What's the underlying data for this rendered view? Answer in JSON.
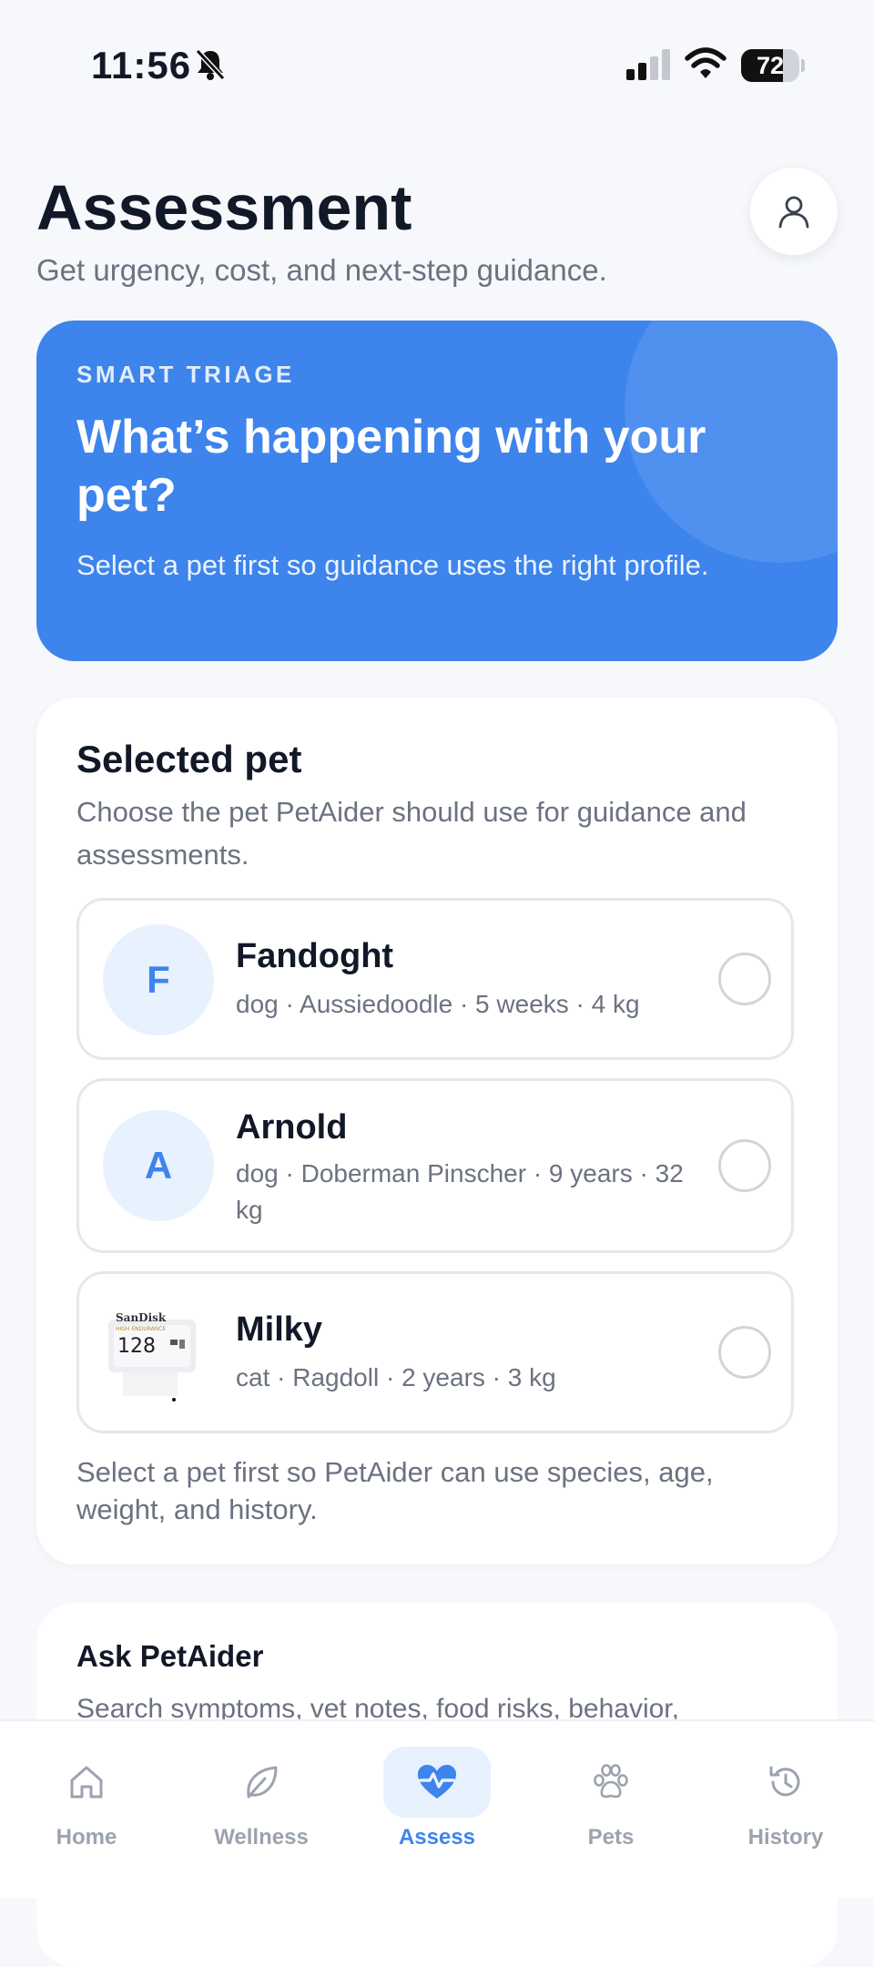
{
  "status_bar": {
    "time": "11:56",
    "battery": "72"
  },
  "header": {
    "title": "Assessment",
    "subtitle": "Get urgency, cost, and next-step guidance."
  },
  "hero": {
    "eyebrow": "SMART TRIAGE",
    "title": "What’s happening with your pet?",
    "subtitle": "Select a pet first so guidance uses the right profile."
  },
  "selected_pet": {
    "title": "Selected pet",
    "description": "Choose the pet PetAider should use for guidance and assessments.",
    "pets": [
      {
        "initial": "F",
        "name": "Fandoght",
        "meta": "dog · Aussiedoodle · 5 weeks · 4 kg",
        "selected": false
      },
      {
        "initial": "A",
        "name": "Arnold",
        "meta": "dog · Doberman Pinscher · 9 years · 32 kg",
        "selected": false
      },
      {
        "initial": "",
        "name": "Milky",
        "meta": "cat · Ragdoll · 2 years · 3 kg",
        "selected": false,
        "photo_text": {
          "brand": "SanDisk",
          "line": "HIGH ENDURANCE",
          "capacity": "128"
        }
      }
    ],
    "footer": "Select a pet first so PetAider can use species, age, weight, and history."
  },
  "ask": {
    "title": "Ask PetAider",
    "description": "Search symptoms, vet notes, food risks, behavior,"
  },
  "tabs": [
    {
      "label": "Home",
      "icon": "home-icon",
      "active": false
    },
    {
      "label": "Wellness",
      "icon": "leaf-icon",
      "active": false
    },
    {
      "label": "Assess",
      "icon": "heart-pulse-icon",
      "active": true
    },
    {
      "label": "Pets",
      "icon": "paw-icon",
      "active": false
    },
    {
      "label": "History",
      "icon": "history-icon",
      "active": false
    }
  ],
  "colors": {
    "accent": "#3d84ec",
    "accent_soft": "#e8f1fe",
    "muted_text": "#6b7280"
  }
}
